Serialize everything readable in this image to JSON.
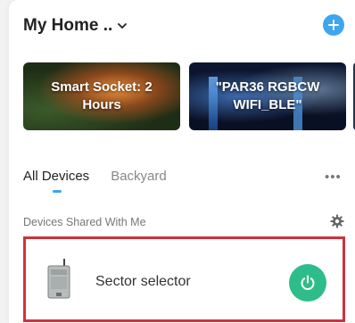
{
  "header": {
    "title": "My Home ..",
    "dropdown_icon": "chevron-down-icon",
    "add_icon": "plus-icon",
    "add_label": "+"
  },
  "scenes": [
    {
      "label": "Smart Socket: 2 Hours"
    },
    {
      "label": "\"PAR36 RGBCW WIFI_BLE\""
    }
  ],
  "tabs": [
    {
      "label": "All Devices",
      "active": true
    },
    {
      "label": "Backyard",
      "active": false
    }
  ],
  "more_label": "•••",
  "section": {
    "label": "Devices Shared With Me",
    "settings_icon": "gear-icon"
  },
  "device": {
    "name": "Sector selector",
    "power_icon": "power-icon"
  },
  "colors": {
    "accent": "#3ea6ee",
    "power_on": "#2ebd8a",
    "highlight_border": "#d0323c"
  }
}
